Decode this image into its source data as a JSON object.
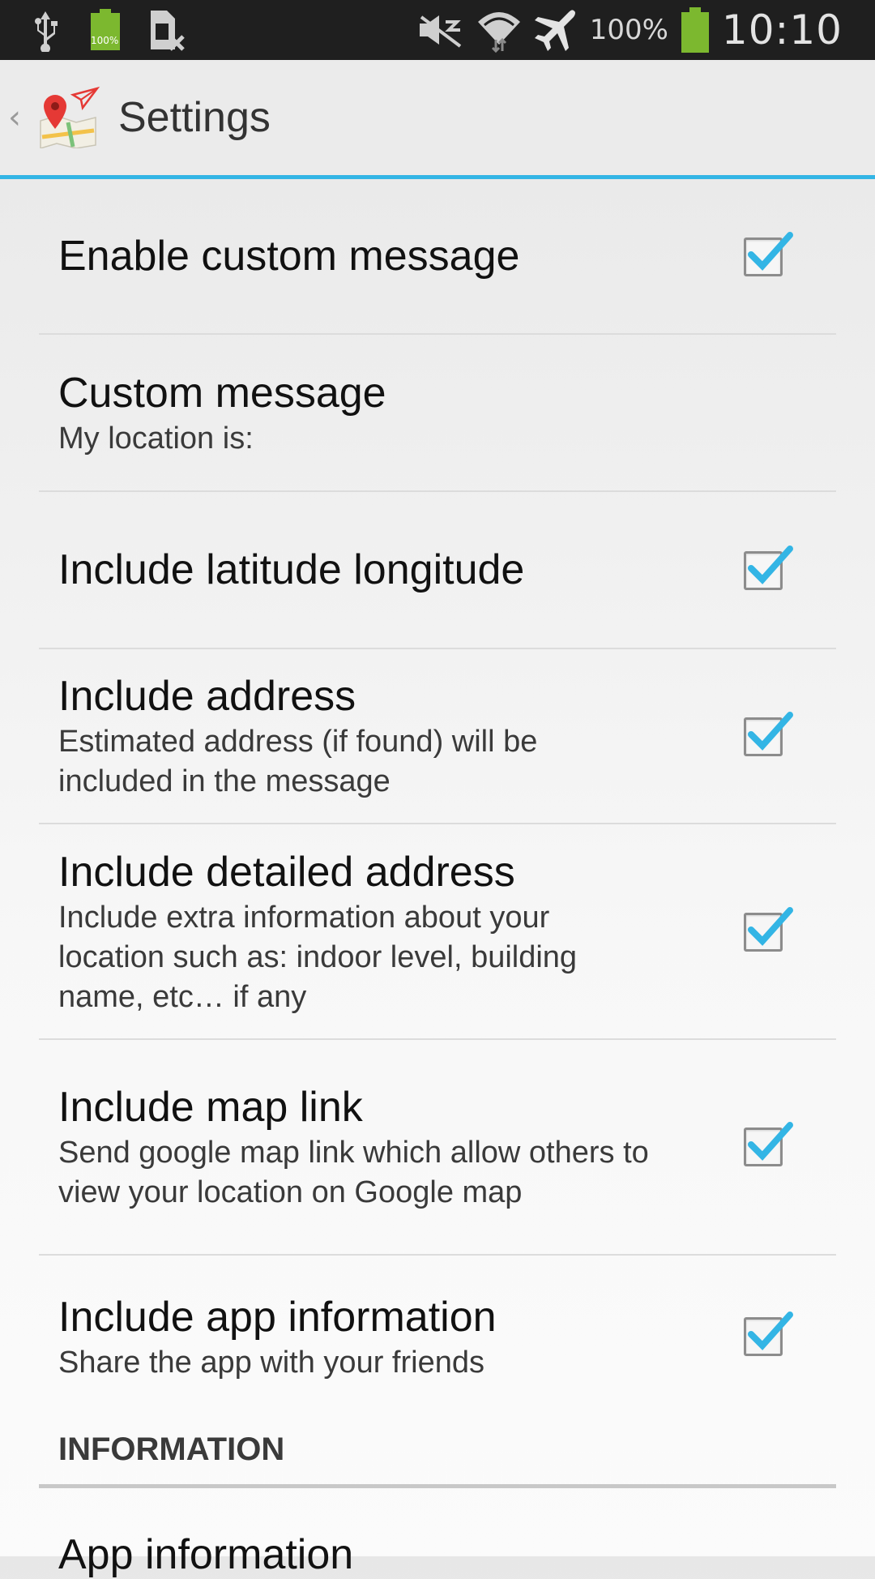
{
  "status_bar": {
    "battery_small_label": "100%",
    "battery_percent": "100%",
    "time": "10:10",
    "icons": [
      "usb-icon",
      "battery-full-icon",
      "sim-error-icon",
      "mute-icon",
      "wifi-icon",
      "airplane-icon",
      "battery-icon"
    ]
  },
  "action_bar": {
    "back_icon": "back-caret-icon",
    "app_icon": "map-pin-plane-icon",
    "title": "Settings"
  },
  "preferences": [
    {
      "title": "Enable custom message",
      "summary": "",
      "checked": true
    },
    {
      "title": "Custom message",
      "summary": "My location is:",
      "checked": null
    },
    {
      "title": "Include latitude longitude",
      "summary": "",
      "checked": true
    },
    {
      "title": "Include address",
      "summary": "Estimated address (if found) will be included in the message",
      "checked": true
    },
    {
      "title": "Include detailed address",
      "summary": "Include extra information about your location such as: indoor level, building name, etc… if any",
      "checked": true
    },
    {
      "title": "Include map link",
      "summary": "Send google map link which allow others to view your location on Google map",
      "checked": true
    },
    {
      "title": "Include app information",
      "summary": "Share the app with your friends",
      "checked": true
    }
  ],
  "section_header": "INFORMATION",
  "cut_off_item": "App information",
  "colors": {
    "accent": "#33b5e5",
    "check": "#33b5e5"
  }
}
